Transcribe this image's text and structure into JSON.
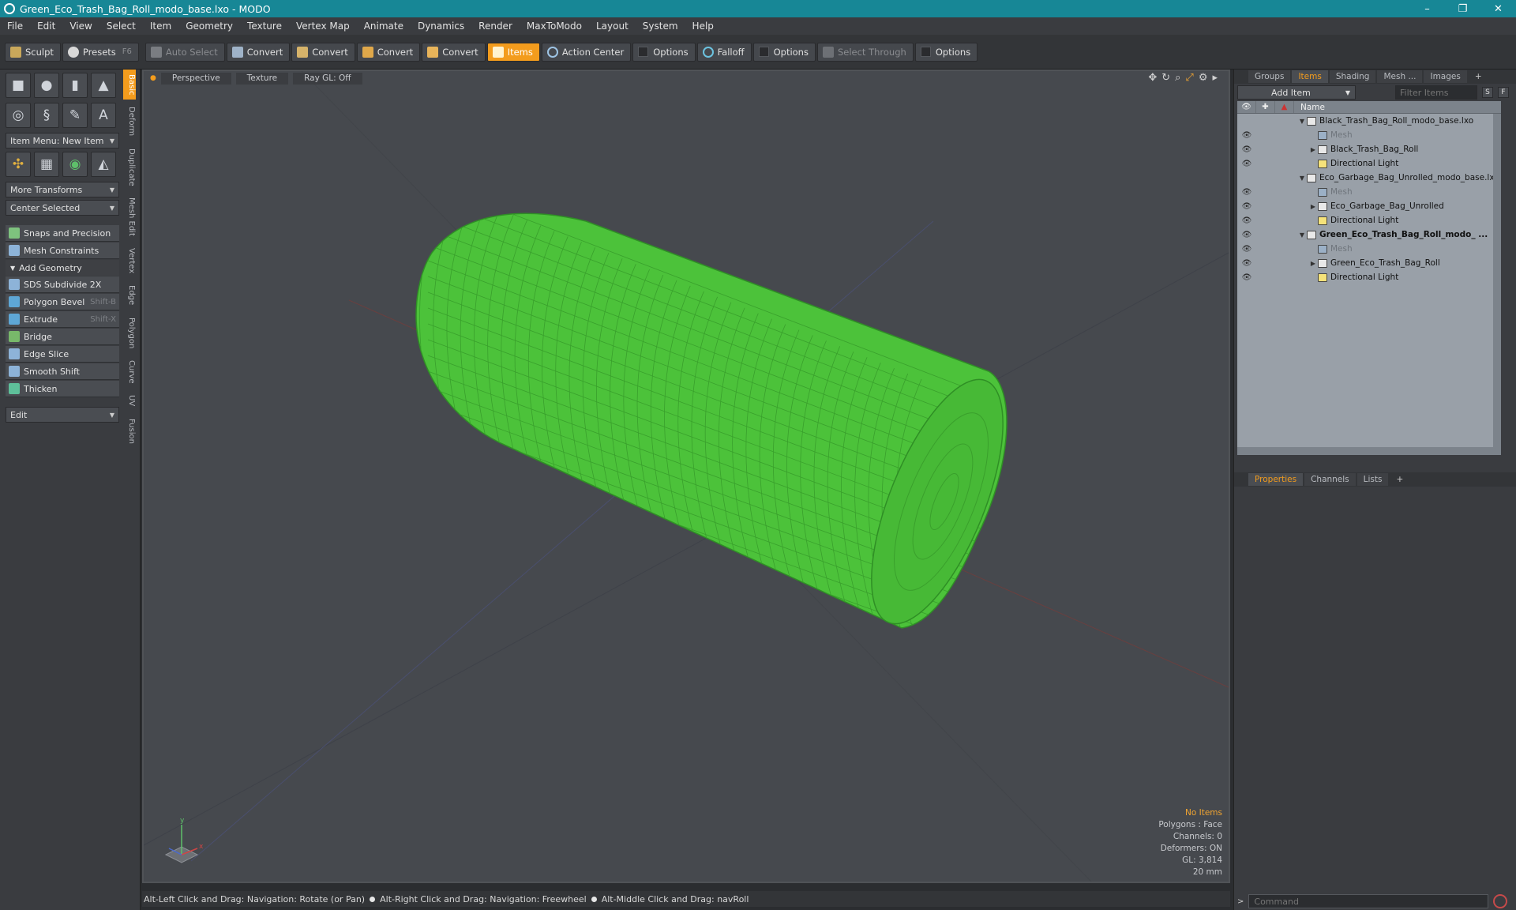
{
  "window": {
    "title": "Green_Eco_Trash_Bag_Roll_modo_base.lxo - MODO",
    "controls": [
      "–",
      "❐",
      "✕"
    ]
  },
  "menu": [
    "File",
    "Edit",
    "View",
    "Select",
    "Item",
    "Geometry",
    "Texture",
    "Vertex Map",
    "Animate",
    "Dynamics",
    "Render",
    "MaxToModo",
    "Layout",
    "System",
    "Help"
  ],
  "toolbar": {
    "sculpt": "Sculpt",
    "presets": "Presets",
    "presets_shortcut": "F6",
    "auto_select": "Auto Select",
    "convert1": "Convert",
    "convert2": "Convert",
    "convert3": "Convert",
    "convert4": "Convert",
    "items": "Items",
    "action_center": "Action Center",
    "options1": "Options",
    "falloff": "Falloff",
    "options2": "Options",
    "select_through": "Select Through",
    "options3": "Options"
  },
  "left": {
    "item_menu": "Item Menu: New Item",
    "more_transforms": "More Transforms",
    "center_selected": "Center Selected",
    "snaps": "Snaps and Precision",
    "mesh_constraints": "Mesh Constraints",
    "add_geometry": "Add Geometry",
    "tools": [
      {
        "label": "SDS Subdivide 2X",
        "shortcut": ""
      },
      {
        "label": "Polygon Bevel",
        "shortcut": "Shift-B"
      },
      {
        "label": "Extrude",
        "shortcut": "Shift-X"
      },
      {
        "label": "Bridge",
        "shortcut": ""
      },
      {
        "label": "Edge Slice",
        "shortcut": ""
      },
      {
        "label": "Smooth Shift",
        "shortcut": ""
      },
      {
        "label": "Thicken",
        "shortcut": ""
      }
    ],
    "edit_dropdown": "Edit",
    "side_tabs": [
      "Basic",
      "Deform",
      "Duplicate",
      "Mesh Edit",
      "Vertex",
      "Edge",
      "Polygon",
      "Curve",
      "UV",
      "Fusion"
    ]
  },
  "viewport": {
    "tabs": [
      "Perspective",
      "Texture",
      "Ray GL: Off"
    ],
    "info": {
      "selection": "No Items",
      "polygons": "Polygons : Face",
      "channels": "Channels: 0",
      "deformers": "Deformers: ON",
      "gl": "GL: 3,814",
      "scale": "20 mm"
    },
    "object_color": "#4cc23a"
  },
  "status": {
    "hint1": "Alt-Left Click and Drag: Navigation: Rotate (or Pan)",
    "hint2": "Alt-Right Click and Drag: Navigation: Freewheel",
    "hint3": "Alt-Middle Click and Drag: navRoll"
  },
  "right": {
    "tabs": [
      "Groups",
      "Items",
      "Shading",
      "Mesh ...",
      "Images"
    ],
    "add_item": "Add Item",
    "filter_placeholder": "Filter Items",
    "btn_s": "S",
    "btn_f": "F",
    "column_name": "Name",
    "items": [
      {
        "label": "Black_Trash_Bag_Roll_modo_base.lxo",
        "type": "scene",
        "caret": "▼",
        "indent": 0,
        "vis": "",
        "dim": false,
        "bold": false
      },
      {
        "label": "Mesh",
        "type": "mesh",
        "caret": "",
        "indent": 1,
        "vis": "👁",
        "dim": true,
        "bold": false
      },
      {
        "label": "Black_Trash_Bag_Roll",
        "type": "locator",
        "caret": "▶",
        "indent": 1,
        "vis": "👁",
        "dim": false,
        "bold": false
      },
      {
        "label": "Directional Light",
        "type": "light",
        "caret": "",
        "indent": 1,
        "vis": "👁",
        "dim": false,
        "bold": false
      },
      {
        "label": "Eco_Garbage_Bag_Unrolled_modo_base.lxo",
        "type": "scene",
        "caret": "▼",
        "indent": 0,
        "vis": "",
        "dim": false,
        "bold": false
      },
      {
        "label": "Mesh",
        "type": "mesh",
        "caret": "",
        "indent": 1,
        "vis": "👁",
        "dim": true,
        "bold": false
      },
      {
        "label": "Eco_Garbage_Bag_Unrolled",
        "type": "locator",
        "caret": "▶",
        "indent": 1,
        "vis": "👁",
        "dim": false,
        "bold": false
      },
      {
        "label": "Directional Light",
        "type": "light",
        "caret": "",
        "indent": 1,
        "vis": "👁",
        "dim": false,
        "bold": false
      },
      {
        "label": "Green_Eco_Trash_Bag_Roll_modo_ ...",
        "type": "scene",
        "caret": "▼",
        "indent": 0,
        "vis": "👁",
        "dim": false,
        "bold": true
      },
      {
        "label": "Mesh",
        "type": "mesh",
        "caret": "",
        "indent": 1,
        "vis": "👁",
        "dim": true,
        "bold": false
      },
      {
        "label": "Green_Eco_Trash_Bag_Roll",
        "type": "locator",
        "caret": "▶",
        "indent": 1,
        "vis": "👁",
        "dim": false,
        "bold": false
      },
      {
        "label": "Directional Light",
        "type": "light",
        "caret": "",
        "indent": 1,
        "vis": "👁",
        "dim": false,
        "bold": false
      }
    ],
    "lower_tabs": [
      "Properties",
      "Channels",
      "Lists"
    ],
    "command_placeholder": "Command"
  }
}
